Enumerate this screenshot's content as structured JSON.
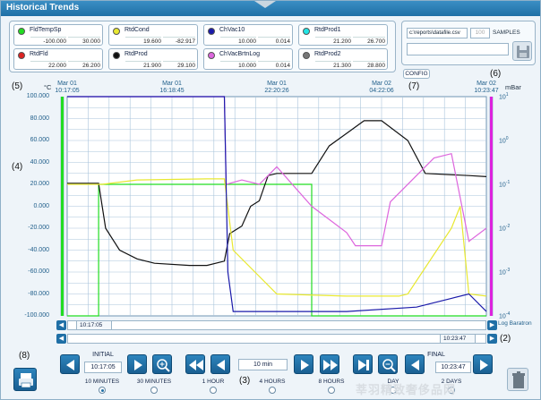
{
  "window": {
    "title": "Historical Trends"
  },
  "pens": [
    {
      "name": "FldTempSp",
      "min": "-100.000",
      "max": "30.000",
      "color": "#22dd22"
    },
    {
      "name": "RtdCond",
      "min": "19.600",
      "max": "-82.917",
      "color": "#e8e830"
    },
    {
      "name": "ChVac10",
      "min": "10.000",
      "max": "0.014",
      "color": "#1a1aaa"
    },
    {
      "name": "RtdProd1",
      "min": "21.200",
      "max": "26.700",
      "color": "#22e6e6"
    },
    {
      "name": "RtdFld",
      "min": "22.000",
      "max": "26.200",
      "color": "#dd2222"
    },
    {
      "name": "RtdProd",
      "min": "21.900",
      "max": "29.100",
      "color": "#111111"
    },
    {
      "name": "ChVacBrtnLog",
      "min": "10.000",
      "max": "0.014",
      "color": "#dd66dd"
    },
    {
      "name": "RtdProd2",
      "min": "21.300",
      "max": "28.800",
      "color": "#777777"
    }
  ],
  "import": {
    "path": "c:\\reports\\datafile.csv",
    "samples_value": "100",
    "samples_label": "SAMPLES"
  },
  "config_label": "CONFIG",
  "annotations": [
    "(1)",
    "(2)",
    "(3)",
    "(4)",
    "(5)",
    "(6)",
    "(7)",
    "(8)"
  ],
  "chart": {
    "left_unit": "°C",
    "right_unit": "mBar",
    "right_axis_name": "Log Baratron",
    "time_labels": [
      {
        "date": "Mar 01",
        "time": "10:17:05"
      },
      {
        "date": "Mar 01",
        "time": "16:18:45"
      },
      {
        "date": "Mar 01",
        "time": "22:20:26"
      },
      {
        "date": "Mar 02",
        "time": "04:22:06"
      },
      {
        "date": "Mar 02",
        "time": "10:23:47"
      }
    ],
    "left_ticks": [
      "100.000",
      "80.000",
      "60.000",
      "40.000",
      "20.000",
      "0.000",
      "-20.000",
      "-40.000",
      "-60.000",
      "-80.000",
      "-100.000"
    ],
    "right_ticks": [
      "10^1",
      "10^0",
      "10^-1",
      "10^-2",
      "10^-3",
      "10^-4"
    ],
    "scroll_start": "10:17:05",
    "scroll_end": "10:23:47"
  },
  "chart_data": {
    "type": "line",
    "title": "",
    "xlabel": "",
    "ylabel": "°C",
    "y2label": "mBar",
    "ylim": [
      -100,
      100
    ],
    "y2lim_log10": [
      -4,
      1
    ],
    "x_range": [
      "Mar 01 10:17:05",
      "Mar 02 10:23:47"
    ],
    "x_unit": "hours from start",
    "series": [
      {
        "name": "FldTempSp",
        "axis": "left",
        "x": [
          0,
          0.4,
          1.8,
          1.8,
          3,
          6,
          9,
          11,
          14,
          14,
          16,
          16,
          19,
          19,
          21,
          21,
          24
        ],
        "y": [
          -100,
          -100,
          -100,
          20,
          20,
          20,
          20,
          20,
          20,
          -100,
          -100,
          -100,
          -100,
          -100,
          -100,
          -100,
          -100
        ]
      },
      {
        "name": "RtdProd",
        "axis": "left",
        "x": [
          0,
          1.8,
          2.2,
          3,
          4,
          5,
          7,
          8,
          9,
          9.3,
          10,
          10.5,
          11,
          11.5,
          12,
          12.5,
          14,
          15,
          17,
          17.5,
          18,
          19.5,
          20.5,
          23,
          24
        ],
        "y": [
          21,
          21,
          -20,
          -40,
          -48,
          -52,
          -54,
          -54,
          -50,
          -25,
          -18,
          0,
          5,
          28,
          30,
          30,
          30,
          55,
          78,
          78,
          78,
          60,
          30,
          28,
          27
        ]
      },
      {
        "name": "RtdCond",
        "axis": "left",
        "x": [
          0,
          2,
          4,
          8,
          9,
          9.5,
          12,
          16,
          19,
          19.5,
          22,
          22.5,
          23,
          24
        ],
        "y": [
          20,
          20,
          24,
          25,
          25,
          -40,
          -80,
          -82,
          -82,
          -80,
          -20,
          0,
          -80,
          -82
        ]
      },
      {
        "name": "ChVacBrtnLog",
        "axis": "right",
        "x": [
          0,
          9,
          9.1,
          10,
          11,
          12,
          14,
          16,
          16.5,
          18,
          18.5,
          21,
          22,
          23,
          24
        ],
        "y": [
          1,
          1,
          -1,
          -0.9,
          -1,
          -0.6,
          -1.5,
          -2.1,
          -2.4,
          -2.4,
          -1.4,
          -0.4,
          -0.3,
          -2.3,
          -2.0
        ]
      },
      {
        "name": "ChVac10",
        "axis": "right",
        "x": [
          0,
          9,
          9.2,
          9.5,
          12,
          16,
          20,
          22,
          23,
          24
        ],
        "y": [
          1,
          1,
          -3,
          -3.9,
          -3.9,
          -3.9,
          -3.8,
          -3.6,
          -3.5,
          -3.9
        ]
      }
    ]
  },
  "nav": {
    "initial_label": "INITIAL",
    "initial_time": "10:17:05",
    "step_value": "10 min",
    "final_label": "FINAL",
    "final_time": "10:23:47",
    "ranges": [
      {
        "label": "10 MINUTES",
        "selected": true
      },
      {
        "label": "30 MINUTES",
        "selected": false
      },
      {
        "label": "1 HOUR",
        "selected": false
      },
      {
        "label": "4 HOURS",
        "selected": false
      },
      {
        "label": "8 HOURS",
        "selected": false
      },
      {
        "label": "DAY",
        "selected": false
      },
      {
        "label": "2 DAYS",
        "selected": false
      }
    ]
  },
  "watermark": "莘羽精致奢侈品网"
}
